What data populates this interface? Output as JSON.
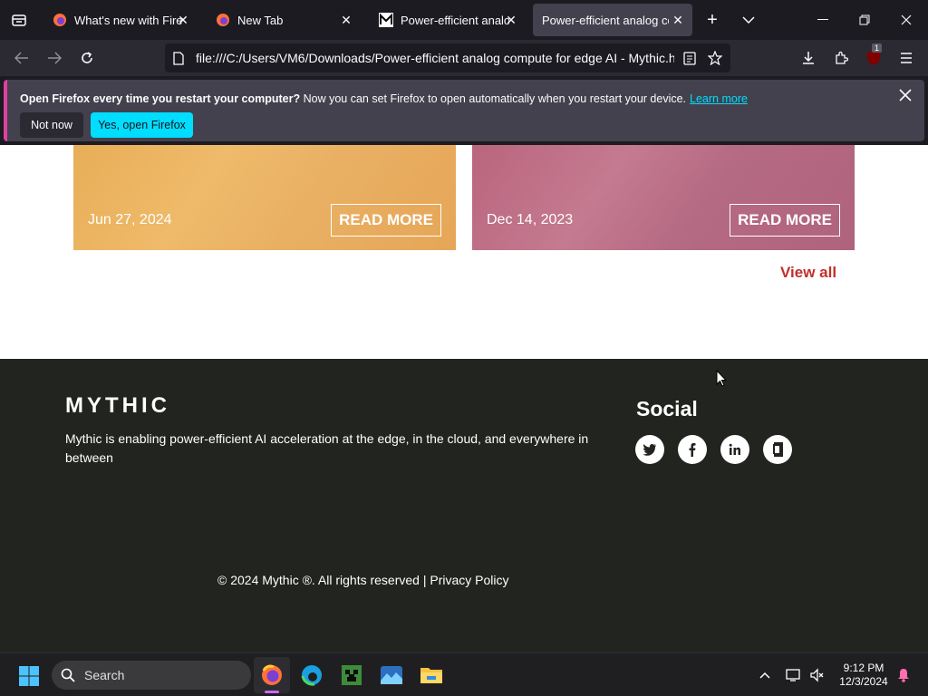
{
  "browser": {
    "tabs": [
      {
        "title": "What's new with Firefox",
        "active": false
      },
      {
        "title": "New Tab",
        "active": false
      },
      {
        "title": "Power-efficient analog",
        "active": false
      },
      {
        "title": "Power-efficient analog con",
        "active": true
      }
    ],
    "url": "file:///C:/Users/VM6/Downloads/Power-efficient analog compute for edge AI - Mythic.h",
    "extension_badge": "1"
  },
  "notification": {
    "bold": "Open Firefox every time you restart your computer?",
    "text": " Now you can set Firefox to open automatically when you restart your device.",
    "link": "Learn more",
    "not_now": "Not now",
    "yes": "Yes, open Firefox"
  },
  "page": {
    "cards": [
      {
        "date": "Jun 27, 2024",
        "button": "READ MORE",
        "color": "#e8ae58"
      },
      {
        "date": "Dec 14, 2023",
        "button": "READ MORE",
        "color": "#b9657e"
      }
    ],
    "view_all": "View all",
    "footer": {
      "logo": "MYTHIC",
      "tagline": "Mythic is enabling power-efficient AI acceleration at the edge, in the cloud, and everywhere in between",
      "social_title": "Social",
      "social_icons": [
        "twitter-icon",
        "facebook-icon",
        "linkedin-icon",
        "glassdoor-icon"
      ],
      "copyright": "© 2024 Mythic ®. All rights reserved | Privacy Policy"
    }
  },
  "taskbar": {
    "search_label": "Search",
    "time": "9:12 PM",
    "date": "12/3/2024"
  },
  "colors": {
    "accent": "#00ddff",
    "view_all": "#c0302b",
    "footer_bg": "#22241f"
  }
}
